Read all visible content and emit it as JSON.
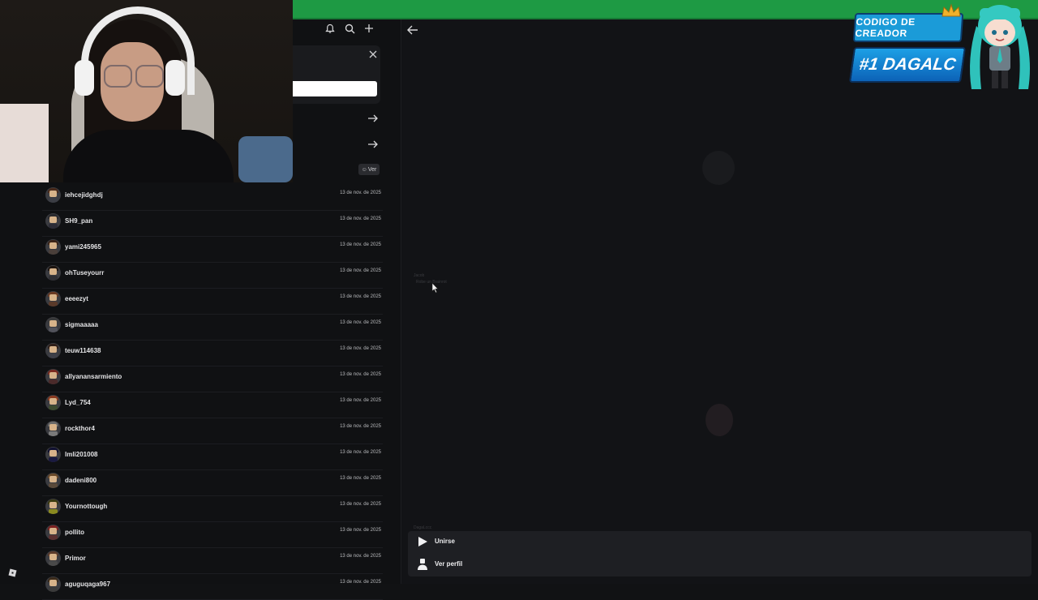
{
  "header": {
    "icons": [
      "bell-icon",
      "search-icon",
      "plus-icon"
    ],
    "back_icon": "arrow-left-icon"
  },
  "search_card": {
    "close_icon": "close-icon",
    "input_value": "",
    "ver_label": "Ver"
  },
  "friends": [
    {
      "name": "iehcejidghdj",
      "date": "13 de nov. de 2025"
    },
    {
      "name": "SH9_pan",
      "date": "13 de nov. de 2025"
    },
    {
      "name": "yami245965",
      "date": "13 de nov. de 2025"
    },
    {
      "name": "ohTuseyourr",
      "date": "13 de nov. de 2025"
    },
    {
      "name": "eeeezyt",
      "date": "13 de nov. de 2025"
    },
    {
      "name": "sigmaaaaa",
      "date": "13 de nov. de 2025"
    },
    {
      "name": "teuw114638",
      "date": "13 de nov. de 2025"
    },
    {
      "name": "allyanansarmiento",
      "date": "13 de nov. de 2025"
    },
    {
      "name": "Lyd_754",
      "date": "13 de nov. de 2025"
    },
    {
      "name": "rockthor4",
      "date": "13 de nov. de 2025"
    },
    {
      "name": "lmli201008",
      "date": "13 de nov. de 2025"
    },
    {
      "name": "dadeni800",
      "date": "13 de nov. de 2025"
    },
    {
      "name": "Yournottough",
      "date": "13 de nov. de 2025"
    },
    {
      "name": "pollito",
      "date": "13 de nov. de 2025"
    },
    {
      "name": "Primor",
      "date": "13 de nov. de 2025"
    },
    {
      "name": "aguguqaga967",
      "date": "13 de nov. de 2025"
    }
  ],
  "overlay": {
    "creator_code": "CODIGO DE CREADOR",
    "creator_name": "#1 DAGALC"
  },
  "detail": {
    "friend_label": "Jacob",
    "friend_game": "Robe un Brainrot",
    "self_label": "DagaLccc"
  },
  "action_menu": {
    "items": [
      {
        "label": "Unirse",
        "icon": "play-icon"
      },
      {
        "label": "Ver perfil",
        "icon": "person-icon"
      }
    ]
  },
  "colors": {
    "accent_green": "#1e9a44",
    "background": "#111214",
    "menu_bg": "#1e1f23"
  }
}
